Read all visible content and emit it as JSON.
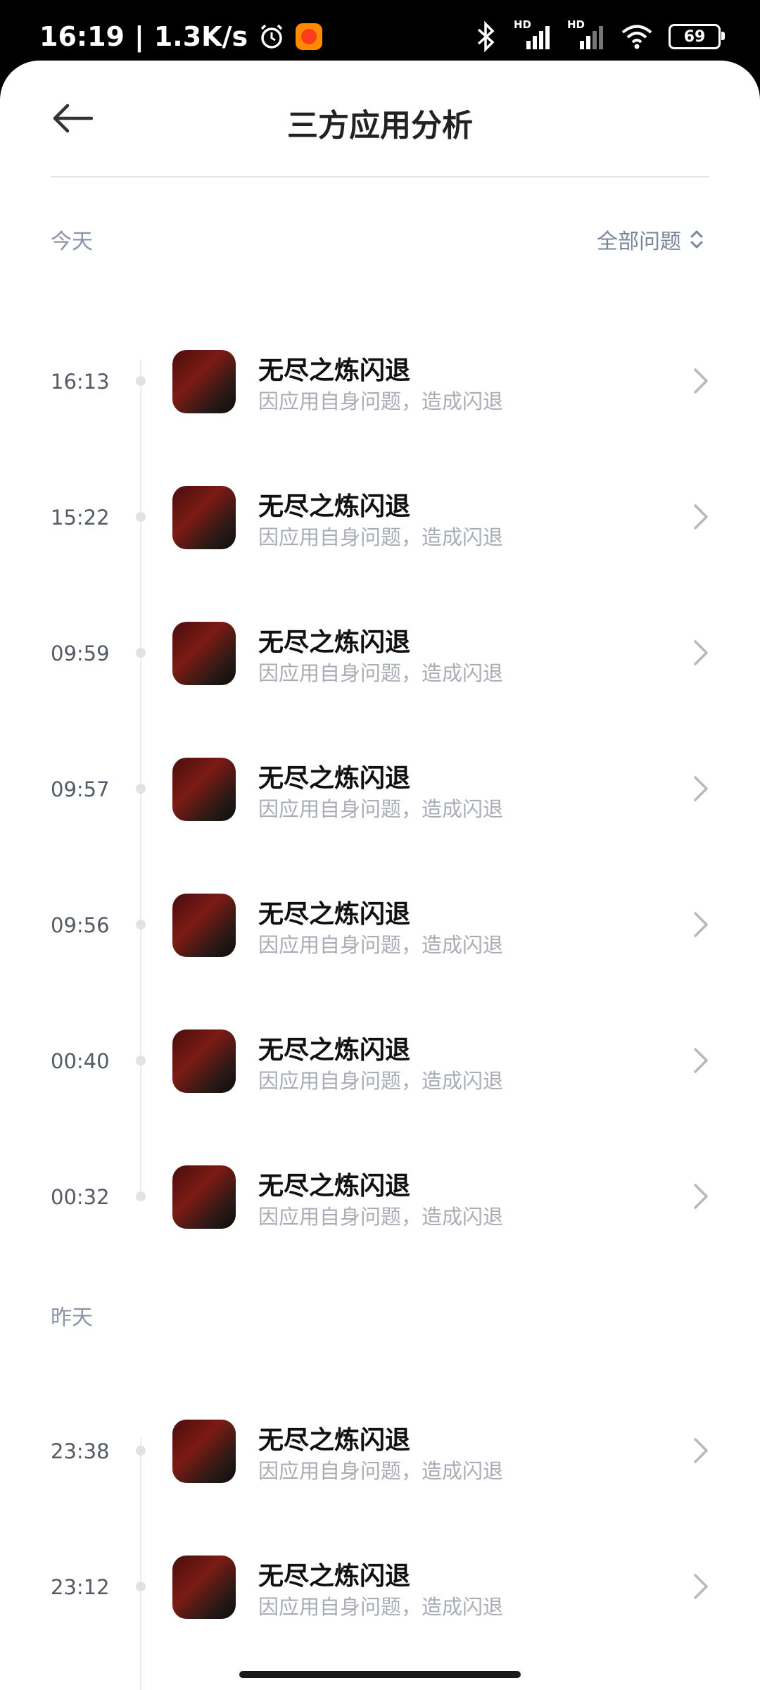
{
  "status_bar": {
    "time": "16:19",
    "separator": "|",
    "network_speed": "1.3K/s",
    "hd_label": "HD",
    "battery": "69"
  },
  "header": {
    "title": "三方应用分析"
  },
  "filter": {
    "label": "全部问题"
  },
  "sections": [
    {
      "label": "今天",
      "items": [
        {
          "time": "16:13",
          "name": "无尽之炼闪退",
          "desc": "因应用自身问题，造成闪退"
        },
        {
          "time": "15:22",
          "name": "无尽之炼闪退",
          "desc": "因应用自身问题，造成闪退"
        },
        {
          "time": "09:59",
          "name": "无尽之炼闪退",
          "desc": "因应用自身问题，造成闪退"
        },
        {
          "time": "09:57",
          "name": "无尽之炼闪退",
          "desc": "因应用自身问题，造成闪退"
        },
        {
          "time": "09:56",
          "name": "无尽之炼闪退",
          "desc": "因应用自身问题，造成闪退"
        },
        {
          "time": "00:40",
          "name": "无尽之炼闪退",
          "desc": "因应用自身问题，造成闪退"
        },
        {
          "time": "00:32",
          "name": "无尽之炼闪退",
          "desc": "因应用自身问题，造成闪退"
        }
      ]
    },
    {
      "label": "昨天",
      "items": [
        {
          "time": "23:38",
          "name": "无尽之炼闪退",
          "desc": "因应用自身问题，造成闪退"
        },
        {
          "time": "23:12",
          "name": "无尽之炼闪退",
          "desc": "因应用自身问题，造成闪退"
        }
      ]
    }
  ],
  "icons": {
    "back": "arrow-left-icon",
    "filter": "sort-updown-icon",
    "chevron": "chevron-right-icon",
    "status": [
      "alarm-icon",
      "bluetooth-icon",
      "signal-icon",
      "wifi-icon",
      "battery-icon"
    ]
  },
  "colors": {
    "background": "#ffffff",
    "title": "#222222",
    "secondary_text": "#a8adb5",
    "section_label": "#8a94a6"
  }
}
